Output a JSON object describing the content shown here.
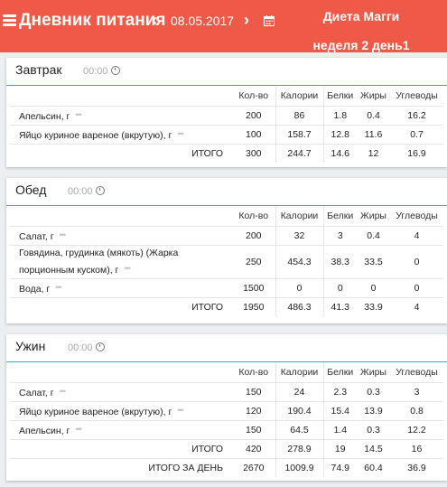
{
  "header": {
    "title": "Дневник питания",
    "prev_label": "‹",
    "date": "08.05.2017",
    "next_label": "›",
    "calendar_icon": "calendar-icon",
    "diet_title": "Диета Магги",
    "diet_week": "неделя 2 день1",
    "bg_color": "#ee5a47"
  },
  "columns": {
    "qty": "Кол-во",
    "kcal": "Калории",
    "protein": "Белки",
    "fat": "Жиры",
    "carbs": "Углеводы"
  },
  "meals": [
    {
      "name": "Завтрак",
      "time": "00:00",
      "rows": [
        {
          "name": "Апельсин, г",
          "qty": "200",
          "kcal": "86",
          "protein": "1.8",
          "fat": "0.4",
          "carbs": "16.2"
        },
        {
          "name": "Яйцо куриное вареное (вкрутую), г",
          "qty": "100",
          "kcal": "158.7",
          "protein": "12.8",
          "fat": "11.6",
          "carbs": "0.7"
        }
      ],
      "total": {
        "label": "ИТОГО",
        "qty": "300",
        "kcal": "244.7",
        "protein": "14.6",
        "fat": "12",
        "carbs": "16.9"
      }
    },
    {
      "name": "Обед",
      "time": "00:00",
      "rows": [
        {
          "name": "Салат, г",
          "qty": "200",
          "kcal": "32",
          "protein": "3",
          "fat": "0.4",
          "carbs": "4"
        },
        {
          "name_line1": "Говядина, грудинка (мякоть) (Жарка",
          "name_line2": "порционным куском), г",
          "qty": "250",
          "kcal": "454.3",
          "protein": "38.3",
          "fat": "33.5",
          "carbs": "0"
        },
        {
          "name": "Вода, г",
          "qty": "1500",
          "kcal": "0",
          "protein": "0",
          "fat": "0",
          "carbs": "0"
        }
      ],
      "total": {
        "label": "ИТОГО",
        "qty": "1950",
        "kcal": "486.3",
        "protein": "41.3",
        "fat": "33.9",
        "carbs": "4"
      }
    },
    {
      "name": "Ужин",
      "time": "00:00",
      "rows": [
        {
          "name": "Салат, г",
          "qty": "150",
          "kcal": "24",
          "protein": "2.3",
          "fat": "0.3",
          "carbs": "3"
        },
        {
          "name": "Яйцо куриное вареное (вкрутую), г",
          "qty": "120",
          "kcal": "190.4",
          "protein": "15.4",
          "fat": "13.9",
          "carbs": "0.8"
        },
        {
          "name": "Апельсин, г",
          "qty": "150",
          "kcal": "64.5",
          "protein": "1.4",
          "fat": "0.3",
          "carbs": "12.2"
        }
      ],
      "total": {
        "label": "ИТОГО",
        "qty": "420",
        "kcal": "278.9",
        "protein": "19",
        "fat": "14.5",
        "carbs": "16"
      },
      "day_total": {
        "label": "ИТОГО ЗА ДЕНЬ",
        "qty": "2670",
        "kcal": "1009.9",
        "protein": "74.9",
        "fat": "60.4",
        "carbs": "36.9"
      }
    }
  ],
  "more_icon": "•••"
}
